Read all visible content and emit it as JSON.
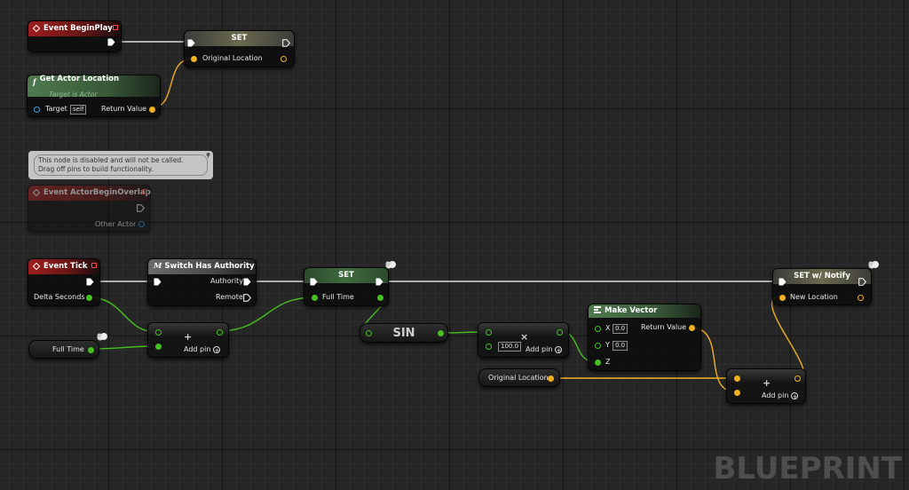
{
  "watermark": "BLUEPRINT",
  "colors": {
    "exec": "#ffffff",
    "float_pin": "#44c020",
    "vector_pin": "#f0b020",
    "object_pin": "#38a0e0",
    "event_header": "#9c1f1f",
    "pure_header": "#4e7a4e"
  },
  "icons": {
    "event": "diamond-icon",
    "function": "function-icon",
    "macro": "macro-icon",
    "make_vector": "vector-icon",
    "replicated": "cloud-icon",
    "add_pin": "plus-circle-icon"
  },
  "nodes": {
    "begin_play": {
      "title": "Event BeginPlay"
    },
    "set1": {
      "title": "SET",
      "pin_in": "Original Location"
    },
    "get_actor_location": {
      "title": "Get Actor Location",
      "subtitle": "Target is Actor",
      "target_label": "Target",
      "target_value": "self",
      "return_label": "Return Value",
      "glyph": "f"
    },
    "disabled_comment": {
      "line1": "This node is disabled and will not be called.",
      "line2": "Drag off pins to build functionality."
    },
    "overlap": {
      "title": "Event ActorBeginOverlap",
      "pin_out": "Other Actor"
    },
    "event_tick": {
      "title": "Event Tick",
      "pin_out": "Delta Seconds"
    },
    "switch_authority": {
      "title": "Switch Has Authority",
      "out1": "Authority",
      "out2": "Remote",
      "glyph": "M"
    },
    "set2": {
      "title": "SET",
      "pin_in": "Full Time"
    },
    "full_time_var": {
      "label": "Full Time"
    },
    "add_float": {
      "symbol": "+",
      "add_pin_label": "Add pin"
    },
    "sin": {
      "label": "SIN"
    },
    "multiply": {
      "symbol": "×",
      "value": "100.0",
      "add_pin_label": "Add pin"
    },
    "make_vector": {
      "title": "Make Vector",
      "x_label": "X",
      "x_value": "0.0",
      "y_label": "Y",
      "y_value": "0.0",
      "z_label": "Z",
      "return_label": "Return Value"
    },
    "original_location_var": {
      "label": "Original Location"
    },
    "add_vector": {
      "symbol": "+",
      "add_pin_label": "Add pin"
    },
    "set_notify": {
      "title": "SET w/ Notify",
      "pin_in": "New Location"
    }
  }
}
